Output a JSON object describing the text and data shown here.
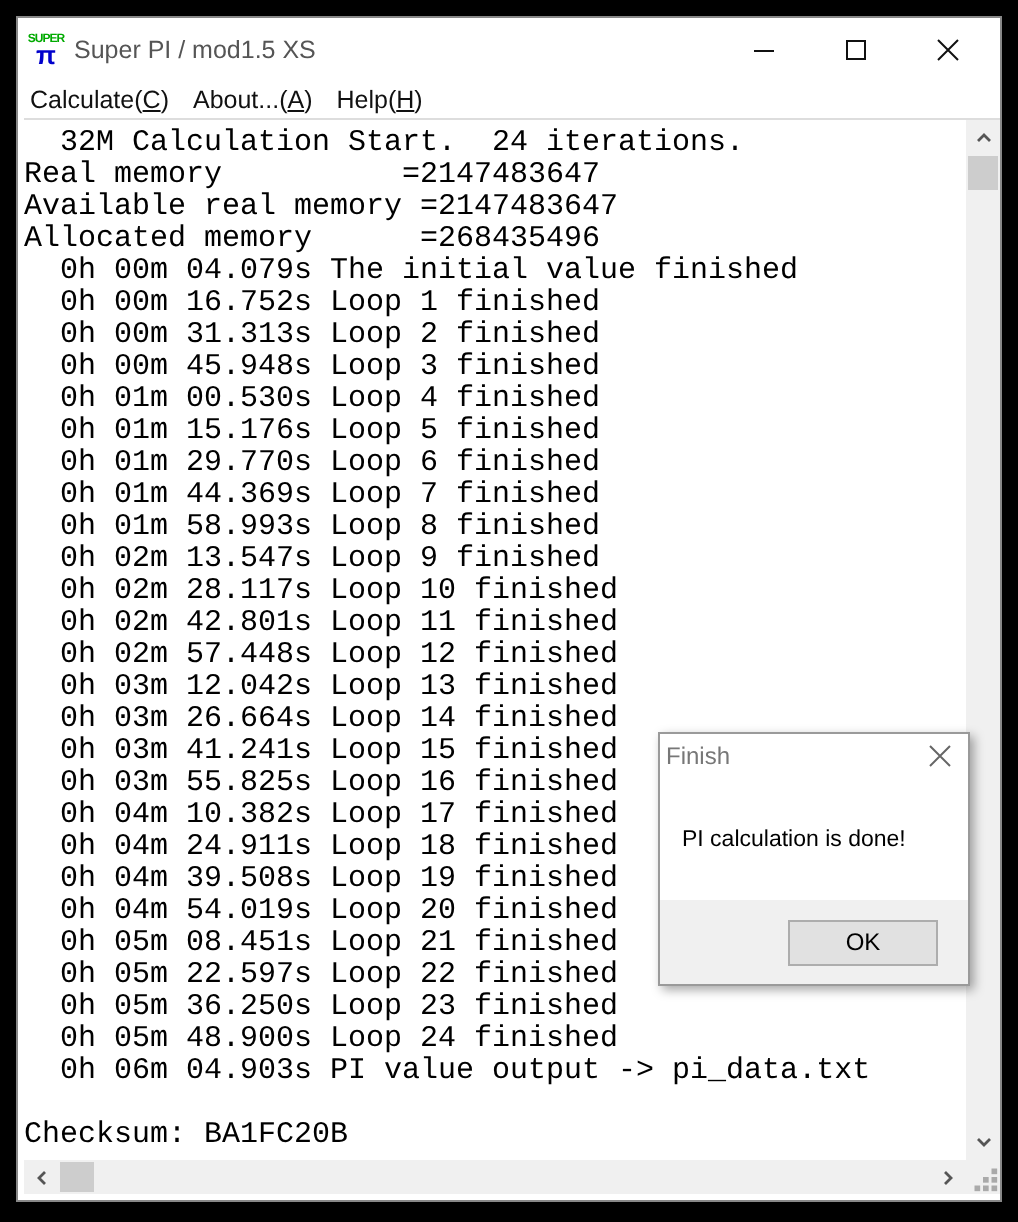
{
  "window": {
    "title": "Super PI / mod1.5 XS",
    "logo_top": "SUPER",
    "logo_bottom": "π"
  },
  "menu": [
    {
      "before": "Calculate(",
      "key": "C",
      "after": ")"
    },
    {
      "before": "About...(",
      "key": "A",
      "after": ")"
    },
    {
      "before": "Help(",
      "key": "H",
      "after": ")"
    }
  ],
  "output_lines": [
    "  32M Calculation Start.  24 iterations.",
    "Real memory          =2147483647",
    "Available real memory =2147483647",
    "Allocated memory      =268435496",
    "  0h 00m 04.079s The initial value finished",
    "  0h 00m 16.752s Loop 1 finished",
    "  0h 00m 31.313s Loop 2 finished",
    "  0h 00m 45.948s Loop 3 finished",
    "  0h 01m 00.530s Loop 4 finished",
    "  0h 01m 15.176s Loop 5 finished",
    "  0h 01m 29.770s Loop 6 finished",
    "  0h 01m 44.369s Loop 7 finished",
    "  0h 01m 58.993s Loop 8 finished",
    "  0h 02m 13.547s Loop 9 finished",
    "  0h 02m 28.117s Loop 10 finished",
    "  0h 02m 42.801s Loop 11 finished",
    "  0h 02m 57.448s Loop 12 finished",
    "  0h 03m 12.042s Loop 13 finished",
    "  0h 03m 26.664s Loop 14 finished",
    "  0h 03m 41.241s Loop 15 finished",
    "  0h 03m 55.825s Loop 16 finished",
    "  0h 04m 10.382s Loop 17 finished",
    "  0h 04m 24.911s Loop 18 finished",
    "  0h 04m 39.508s Loop 19 finished",
    "  0h 04m 54.019s Loop 20 finished",
    "  0h 05m 08.451s Loop 21 finished",
    "  0h 05m 22.597s Loop 22 finished",
    "  0h 05m 36.250s Loop 23 finished",
    "  0h 05m 48.900s Loop 24 finished",
    "  0h 06m 04.903s PI value output -> pi_data.txt"
  ],
  "checksum_lines": [
    "Checksum: BA1FC20B"
  ],
  "dialog": {
    "title": "Finish",
    "message": "PI calculation is done!",
    "buttons": [
      "OK"
    ]
  }
}
